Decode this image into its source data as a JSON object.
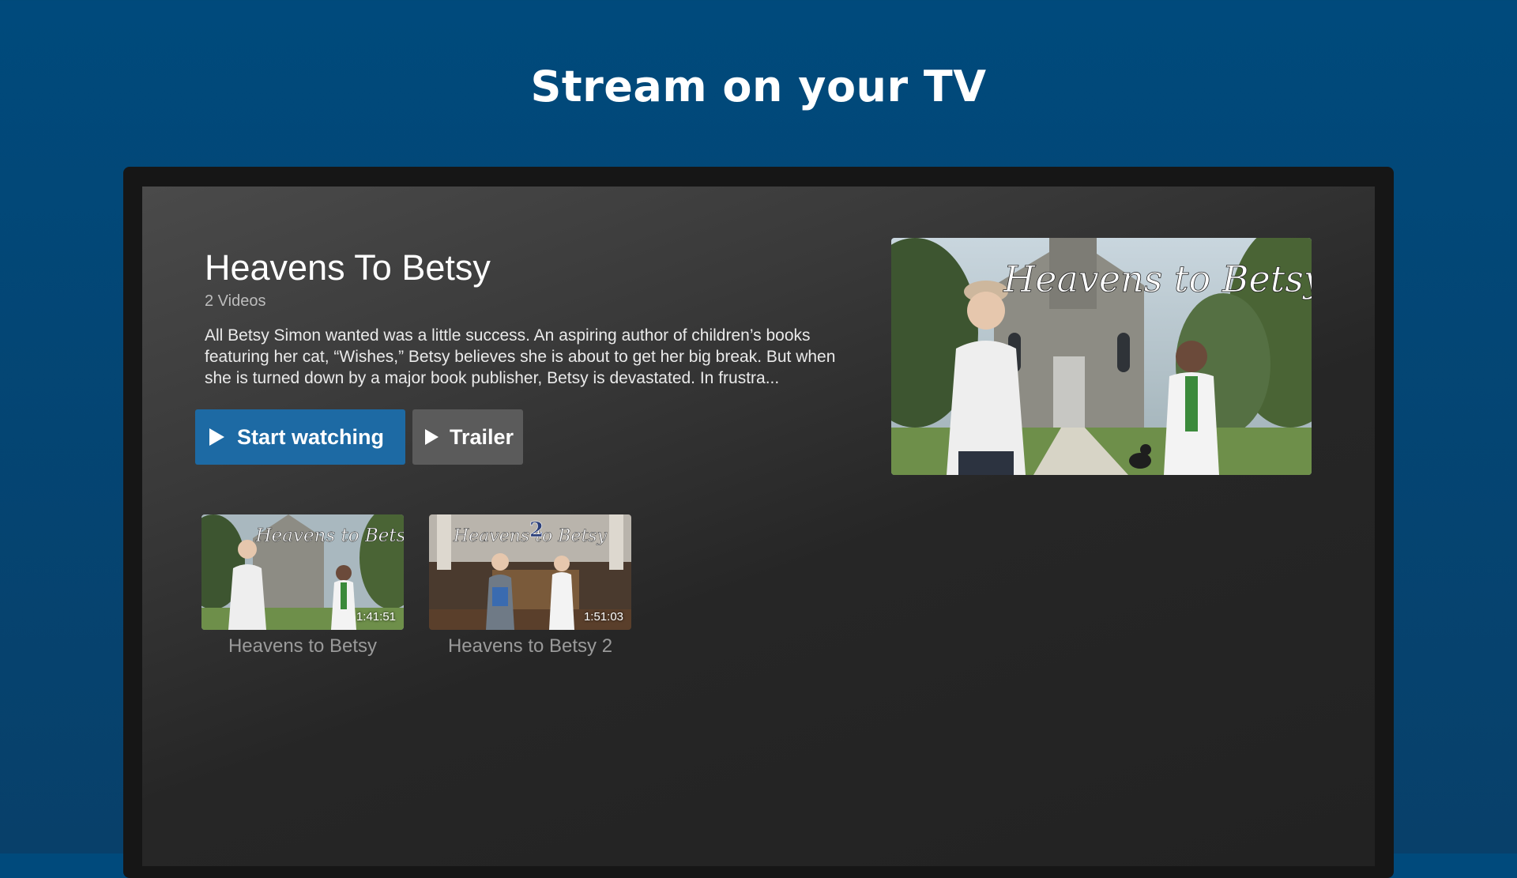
{
  "banner": {
    "title": "Stream on your TV"
  },
  "show": {
    "title": "Heavens To Betsy",
    "video_count": "2 Videos",
    "description": "All Betsy Simon wanted was a little success. An aspiring author of children’s books featuring her cat, “Wishes,” Betsy believes she is about to get her big break. But when she is turned down by a major book publisher, Betsy is devastated. In frustra..."
  },
  "buttons": {
    "start_watching": "Start watching",
    "trailer": "Trailer"
  },
  "feature_art": {
    "logo_text": "Heavens to Betsy"
  },
  "videos": [
    {
      "title": "Heavens to Betsy",
      "duration": "1:41:51",
      "logo_text": "Heavens to Betsy"
    },
    {
      "title": "Heavens to Betsy 2",
      "duration": "1:51:03",
      "logo_text": "Heavens to Betsy",
      "logo_number": "2"
    }
  ],
  "colors": {
    "background": "#004a7c",
    "primary_button": "#1d6aa4",
    "secondary_button": "#5b5b5b"
  },
  "icons": {
    "play": "play-icon"
  }
}
